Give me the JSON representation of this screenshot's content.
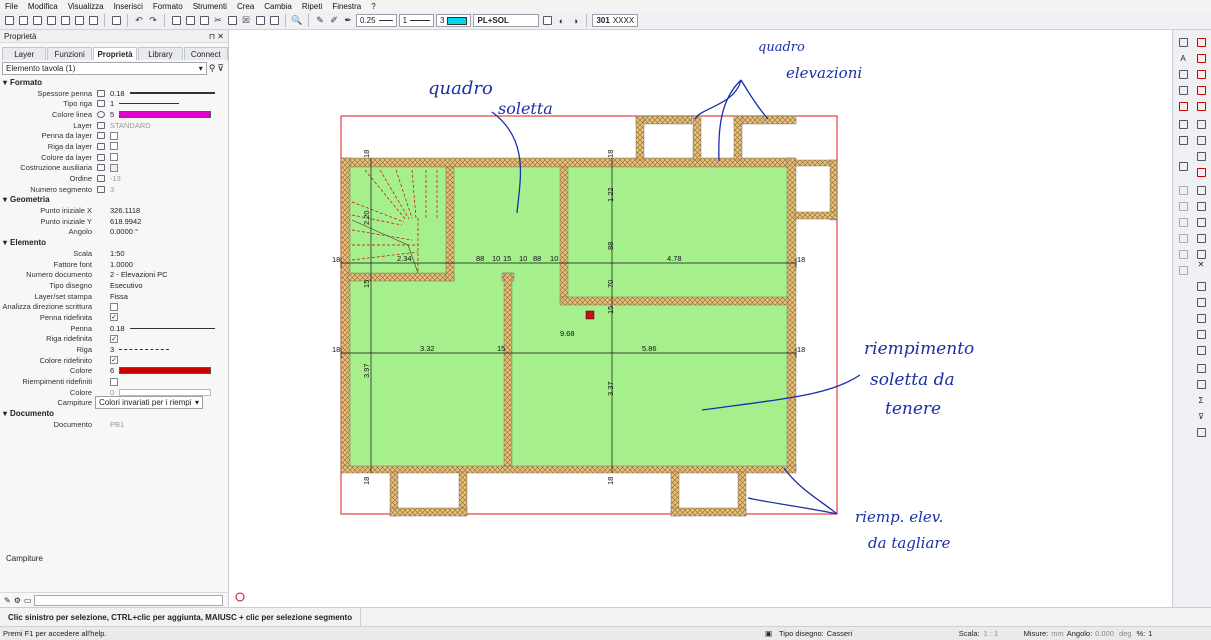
{
  "menu": [
    "File",
    "Modifica",
    "Visualizza",
    "Inserisci",
    "Formato",
    "Strumenti",
    "Crea",
    "Cambia",
    "Ripeti",
    "Finestra",
    "?"
  ],
  "toolbar": {
    "pen_value": "0.25",
    "line_value": "1",
    "color_value": "3",
    "layer": "PL+SOL",
    "counter": "301",
    "color_accent": "#00d8f0"
  },
  "panel": {
    "title": "Proprietà",
    "tabs": [
      "Layer",
      "Funzioni",
      "Proprietà",
      "Library",
      "Connect"
    ],
    "element": "Elemento tavola (1)",
    "sections": {
      "formato": "Formato",
      "geometria": "Geometria",
      "elemento": "Elemento",
      "documento": "Documento"
    },
    "formato": [
      {
        "label": "Spessore penna",
        "value": "0.18"
      },
      {
        "label": "Tipo riga",
        "value": "1"
      },
      {
        "label": "Colore linea",
        "value": "5"
      },
      {
        "label": "Layer",
        "value": "STANDARD"
      },
      {
        "label": "Penna da layer",
        "value": ""
      },
      {
        "label": "Riga da layer",
        "value": ""
      },
      {
        "label": "Colore da layer",
        "value": ""
      },
      {
        "label": "Costruzione ausiliaria",
        "value": ""
      },
      {
        "label": "Ordine",
        "value": "-13"
      },
      {
        "label": "Numero segmento",
        "value": "3"
      }
    ],
    "geometria": [
      {
        "label": "Punto iniziale X",
        "value": "326.1118"
      },
      {
        "label": "Punto iniziale Y",
        "value": "618.9942"
      },
      {
        "label": "Angolo",
        "value": "0.0000 °"
      }
    ],
    "elemento": [
      {
        "label": "Scala",
        "value": "1:50"
      },
      {
        "label": "Fattore font",
        "value": "1.0000"
      },
      {
        "label": "Numero documento",
        "value": "2 - Elevazioni PC"
      },
      {
        "label": "Tipo disegno",
        "value": "Esecutivo"
      },
      {
        "label": "Layer/set stampa",
        "value": "Fissa"
      },
      {
        "label": "Analizza direzione scrittura",
        "value": ""
      },
      {
        "label": "Penna ridefinita",
        "value": ""
      },
      {
        "label": "Penna",
        "value": "0.18"
      },
      {
        "label": "Riga ridefinita",
        "value": ""
      },
      {
        "label": "Riga",
        "value": "3"
      },
      {
        "label": "Colore ridefinito",
        "value": ""
      },
      {
        "label": "Colore",
        "value": "6"
      },
      {
        "label": "Riempimenti ridefiniti",
        "value": ""
      },
      {
        "label": "Colore",
        "value": "0"
      },
      {
        "label": "Campiture",
        "value": "Colori invariati per i riempime"
      }
    ],
    "documento": [
      {
        "label": "Documento",
        "value": "PB1"
      }
    ],
    "bottom_label": "Campiture",
    "colors": {
      "line": "#e000d0",
      "fill": "#d00000"
    }
  },
  "drawing": {
    "dims": {
      "d18": "18",
      "d220": "2.20",
      "d234": "2.34",
      "d88": "88",
      "d10": "10",
      "d15": "15",
      "d478": "4.78",
      "d122": "1.22",
      "d70": "70",
      "d968": "9.68",
      "d332": "3.32",
      "d586": "5.86",
      "d397": "3.97",
      "d337": "3.37"
    },
    "notes": {
      "n1a": "quadro",
      "n1b": "soletta",
      "n2a": "quadro",
      "n2b": "elevazioni",
      "n3a": "riempimento",
      "n3b": "soletta da",
      "n3c": "tenere",
      "n4a": "riemp. elev.",
      "n4b": "da tagliare"
    },
    "colors": {
      "slab": "#a5f08c",
      "wall": "#e8c07a",
      "border": "#e00000",
      "ink": "#1a2fa8"
    }
  },
  "status": {
    "message": "Clic sinistro per selezione, CTRL+clic per aggiunta, MAIUSC + clic per selezione segmento",
    "help": "Premi F1 per accedere all'help.",
    "tipo_label": "Tipo disegno:",
    "tipo_value": "Casseri",
    "scala_label": "Scala:",
    "scala_value": "1 : 1",
    "misure_label": "Misure:",
    "misure_value": "mm",
    "angolo_label": "Angolo:",
    "angolo_value": "0.000",
    "deg": "deg",
    "percent_label": "%:",
    "percent_value": "1"
  }
}
